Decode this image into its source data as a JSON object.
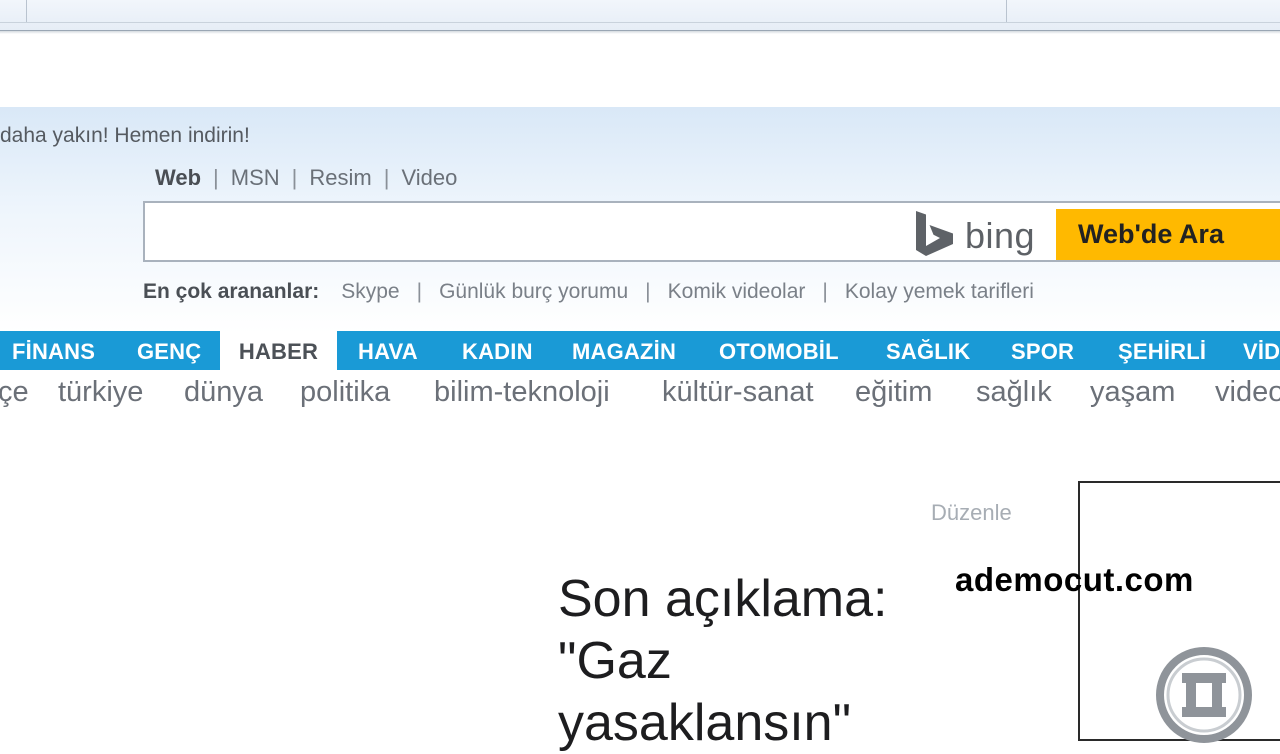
{
  "promo_text": "daha yakın! Hemen indirin!",
  "search": {
    "tabs": [
      "Web",
      "MSN",
      "Resim",
      "Video"
    ],
    "placeholder": "",
    "value": "",
    "logo_text": "bing",
    "button_label": "Web'de Ara"
  },
  "popular": {
    "label": "En çok arananlar:",
    "items": [
      "Skype",
      "Günlük burç yorumu",
      "Komik videolar",
      "Kolay yemek tarifleri"
    ]
  },
  "categories": {
    "items": [
      "FİNANS",
      "GENÇ",
      "HABER",
      "HAVA",
      "KADIN",
      "MAGAZİN",
      "OTOMOBİL",
      "SAĞLIK",
      "SPOR",
      "ŞEHİRLİ",
      "VİD"
    ],
    "active": "HABER"
  },
  "subnav": [
    "çe",
    "türkiye",
    "dünya",
    "politika",
    "bilim-teknoloji",
    "kültür-sanat",
    "eğitim",
    "sağlık",
    "yaşam",
    "video"
  ],
  "edit_label": "Düzenle",
  "headline": "Son açıklama: \"Gaz yasaklansın\"",
  "watermark": "ademocut.com",
  "colors": {
    "category_bar": "#1a9ad6",
    "search_button": "#ffb900",
    "header_band": "#d9e8f7"
  }
}
